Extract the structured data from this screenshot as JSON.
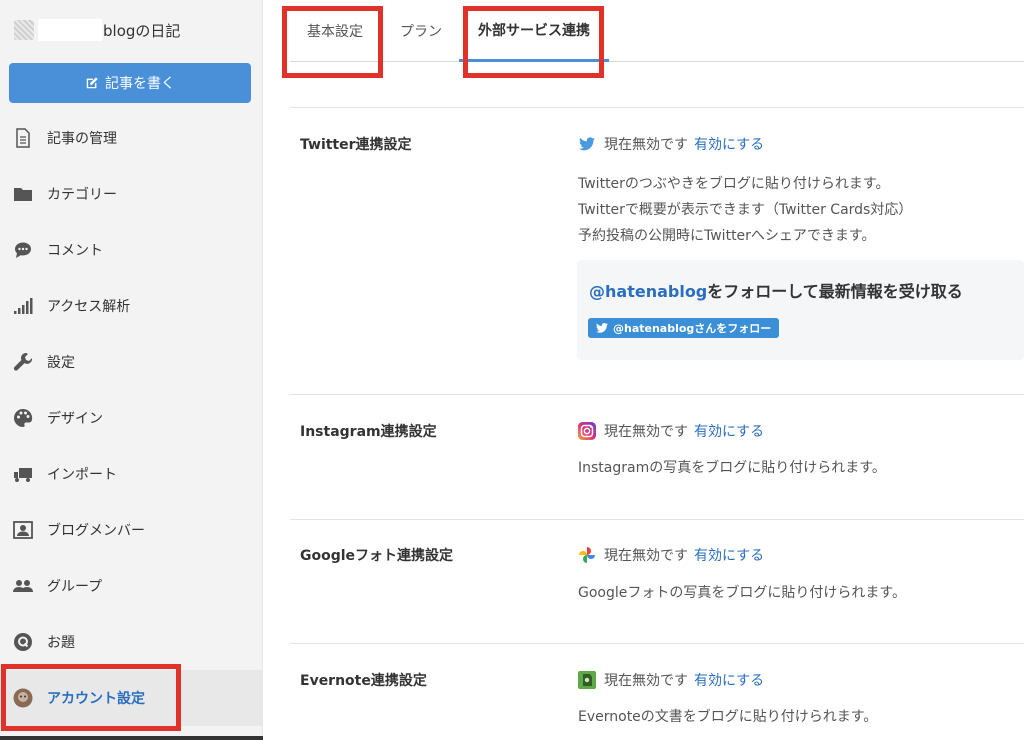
{
  "sidebar": {
    "blog_title": "blogの日記",
    "write_button": "記事を書く",
    "items": [
      {
        "label": "記事の管理",
        "icon": "document-icon"
      },
      {
        "label": "カテゴリー",
        "icon": "folder-icon"
      },
      {
        "label": "コメント",
        "icon": "comment-icon"
      },
      {
        "label": "アクセス解析",
        "icon": "signal-bars-icon"
      },
      {
        "label": "設定",
        "icon": "wrench-icon"
      },
      {
        "label": "デザイン",
        "icon": "palette-icon"
      },
      {
        "label": "インポート",
        "icon": "truck-icon"
      },
      {
        "label": "ブログメンバー",
        "icon": "member-card-icon"
      },
      {
        "label": "グループ",
        "icon": "group-icon"
      },
      {
        "label": "お題",
        "icon": "q-badge-icon"
      },
      {
        "label": "アカウント設定",
        "icon": "avatar-icon",
        "active": true
      }
    ]
  },
  "tabs": [
    {
      "label": "基本設定"
    },
    {
      "label": "プラン"
    },
    {
      "label": "外部サービス連携",
      "active": true
    }
  ],
  "sections": {
    "twitter": {
      "title": "Twitter連携設定",
      "status": "現在無効です",
      "action": "有効にする",
      "desc": [
        "Twitterのつぶやきをブログに貼り付けられます。",
        "Twitterで概要が表示できます（Twitter Cards対応）",
        "予約投稿の公開時にTwitterへシェアできます。"
      ],
      "follow_handle": "@hatenablog",
      "follow_text": "をフォローして最新情報を受け取る",
      "follow_button": "@hatenablogさんをフォロー"
    },
    "instagram": {
      "title": "Instagram連携設定",
      "status": "現在無効です",
      "action": "有効にする",
      "desc": "Instagramの写真をブログに貼り付けられます。"
    },
    "google_photos": {
      "title": "Googleフォト連携設定",
      "status": "現在無効です",
      "action": "有効にする",
      "desc": "Googleフォトの写真をブログに貼り付けられます。"
    },
    "evernote": {
      "title": "Evernote連携設定",
      "status": "現在無効です",
      "action": "有効にする",
      "desc": "Evernoteの文書をブログに貼り付けられます。"
    }
  },
  "colors": {
    "accent": "#4a90d9",
    "link": "#2a6fbf",
    "highlight": "#e0312a"
  }
}
